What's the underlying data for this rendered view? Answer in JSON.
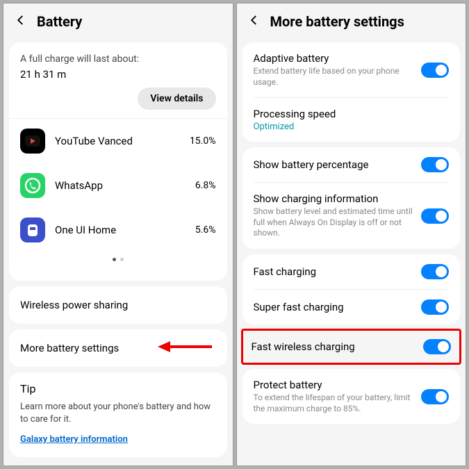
{
  "left": {
    "title": "Battery",
    "charge_label": "A full charge will last about:",
    "charge_time": "21 h 31 m",
    "view_details": "View details",
    "apps": [
      {
        "name": "YouTube Vanced",
        "pct": "15.0%"
      },
      {
        "name": "WhatsApp",
        "pct": "6.8%"
      },
      {
        "name": "One UI Home",
        "pct": "5.6%"
      }
    ],
    "wireless_power": "Wireless power sharing",
    "more_settings": "More battery settings",
    "tip_title": "Tip",
    "tip_text": "Learn more about your phone's battery and how to care for it.",
    "tip_link": "Galaxy battery information"
  },
  "right": {
    "title": "More battery settings",
    "adaptive_title": "Adaptive battery",
    "adaptive_sub": "Extend battery life based on your phone usage.",
    "proc_title": "Processing speed",
    "proc_sub": "Optimized",
    "show_pct": "Show battery percentage",
    "show_charging": "Show charging information",
    "show_charging_sub": "Show battery level and estimated time until full when Always On Display is off or not shown.",
    "fast": "Fast charging",
    "super_fast": "Super fast charging",
    "fast_wireless": "Fast wireless charging",
    "protect": "Protect battery",
    "protect_sub": "To extend the lifespan of your battery, limit the maximum charge to 85%."
  }
}
